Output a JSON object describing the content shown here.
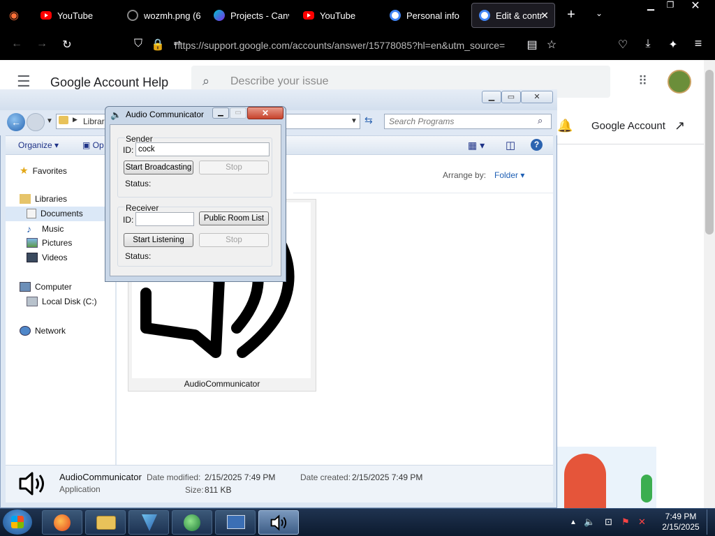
{
  "browser": {
    "tabs": [
      {
        "label": "YouTube",
        "favicon": "youtube-icon"
      },
      {
        "label": "wozmh.png (6",
        "favicon": "image-icon"
      },
      {
        "label": "Projects - Canv",
        "favicon": "canva-icon"
      },
      {
        "label": "YouTube",
        "favicon": "youtube-icon"
      },
      {
        "label": "Personal info",
        "favicon": "google-icon"
      },
      {
        "label": "Edit & contr",
        "favicon": "google-icon",
        "active": true
      }
    ],
    "url": "https://support.google.com/accounts/answer/15778085?hl=en&utm_source="
  },
  "google": {
    "title": "Google Account Help",
    "search_placeholder": "Describe your issue",
    "account_link": "Google Account"
  },
  "explorer": {
    "address": "Librar",
    "search_placeholder": "Search Programs",
    "toolbar": {
      "organize": "Organize",
      "open": "Op"
    },
    "arrange_label": "Arrange by:",
    "arrange_value": "Folder",
    "nav": {
      "favorites": "Favorites",
      "libraries": "Libraries",
      "documents": "Documents",
      "music": "Music",
      "pictures": "Pictures",
      "videos": "Videos",
      "computer": "Computer",
      "local_disk": "Local Disk (C:)",
      "network": "Network"
    },
    "file": {
      "name": "AudioCommunicator",
      "type": "Application",
      "date_modified_label": "Date modified:",
      "date_modified": "2/15/2025 7:49 PM",
      "date_created_label": "Date created:",
      "date_created": "2/15/2025 7:49 PM",
      "size_label": "Size:",
      "size": "811 KB"
    }
  },
  "dialog": {
    "title": "Audio Communicator",
    "sender": {
      "group": "Sender",
      "id_label": "ID:",
      "id_value": "cock",
      "start": "Start Broadcasting",
      "stop": "Stop",
      "status_label": "Status:"
    },
    "receiver": {
      "group": "Receiver",
      "id_label": "ID:",
      "id_value": "",
      "public_rooms": "Public Room List",
      "start": "Start Listening",
      "stop": "Stop",
      "status_label": "Status:"
    }
  },
  "taskbar": {
    "time": "7:49 PM",
    "date": "2/15/2025"
  }
}
